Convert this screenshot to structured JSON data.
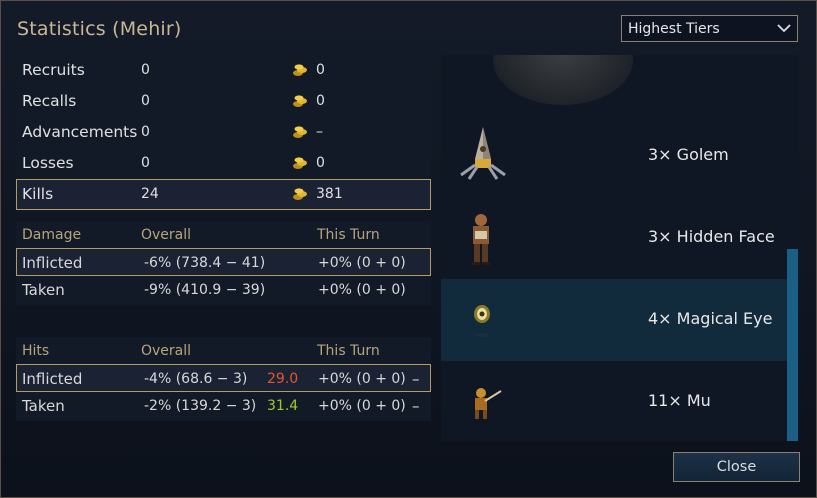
{
  "title": "Statistics (Mehir)",
  "dropdown": {
    "selected": "Highest Tiers"
  },
  "summary": [
    {
      "label": "Recruits",
      "count": "0",
      "gold": "0"
    },
    {
      "label": "Recalls",
      "count": "0",
      "gold": "0"
    },
    {
      "label": "Advancements",
      "count": "0",
      "gold": "–"
    },
    {
      "label": "Losses",
      "count": "0",
      "gold": "0"
    },
    {
      "label": "Kills",
      "count": "24",
      "gold": "381"
    }
  ],
  "damage": {
    "headers": [
      "Damage",
      "Overall",
      "This Turn"
    ],
    "rows": [
      {
        "label": "Inflicted",
        "overall": "-6% (738.4 − 41)",
        "turn": "+0% (0 + 0)"
      },
      {
        "label": "Taken",
        "overall": "-9% (410.9 − 39)",
        "turn": "+0% (0 + 0)"
      }
    ]
  },
  "hits": {
    "headers": [
      "Hits",
      "Overall",
      "This Turn"
    ],
    "rows": [
      {
        "label": "Inflicted",
        "overall": "-4% (68.6 − 3)",
        "rating": "29.0",
        "rating_color": "#e0582c",
        "turn": "+0% (0 + 0)",
        "dash": "–"
      },
      {
        "label": "Taken",
        "overall": "-2% (139.2 − 3)",
        "rating": "31.4",
        "rating_color": "#9ccc2c",
        "turn": "+0% (0 + 0)",
        "dash": "–"
      }
    ]
  },
  "units": [
    {
      "name": "3× Golem",
      "icon": "golem-unit-icon"
    },
    {
      "name": "3× Hidden Face",
      "icon": "hidden-face-unit-icon"
    },
    {
      "name": "4× Magical Eye",
      "icon": "magical-eye-unit-icon"
    },
    {
      "name": "11× Mu",
      "icon": "mu-unit-icon"
    }
  ],
  "close_label": "Close"
}
